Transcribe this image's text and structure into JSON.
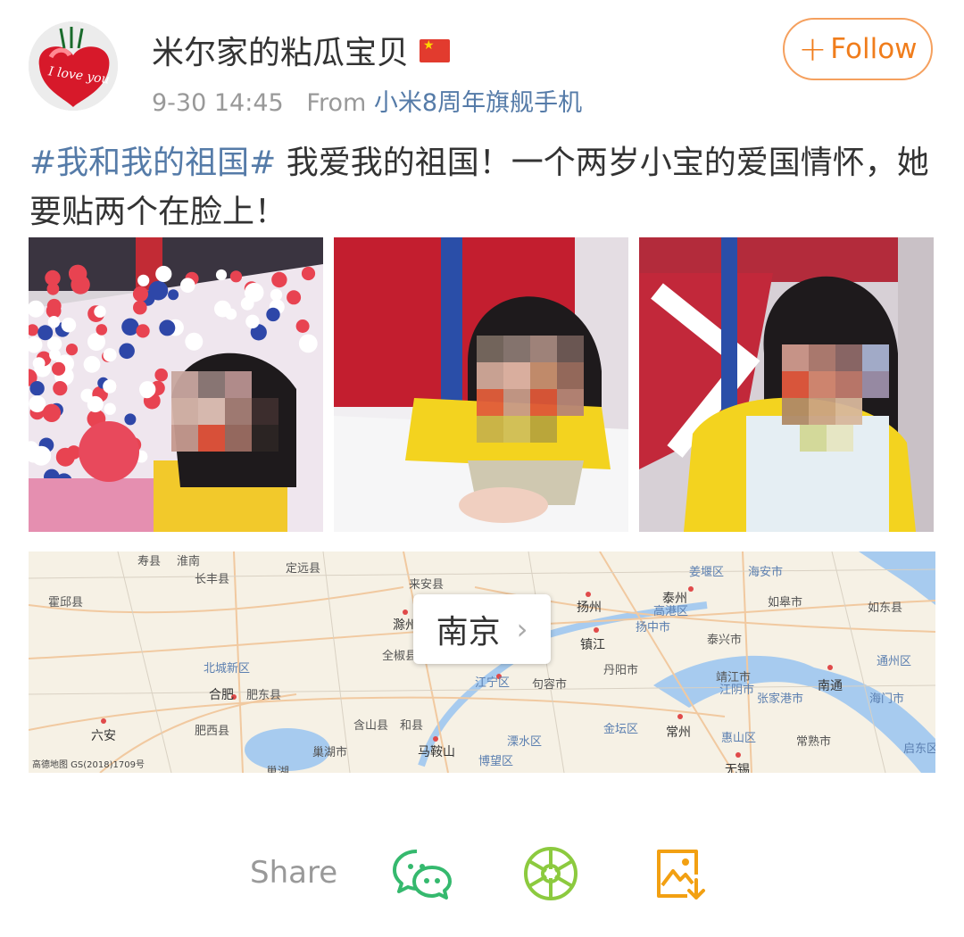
{
  "post": {
    "username": "米尔家的粘瓜宝贝",
    "time": "9-30 14:45",
    "from_prefix": "From",
    "source": "小米8周年旗舰手机",
    "follow_label": "Follow",
    "follow_plus": "+",
    "hashtag": "#我和我的祖国#",
    "body": " 我爱我的祖国！一个两岁小宝的爱国情怀，她要贴两个在脸上！",
    "avatar_text": "I love you"
  },
  "map": {
    "city": "南京",
    "credit": "高德地图 GS(2018)1709号",
    "labels": [
      "寿县",
      "淮南",
      "定远县",
      "来安县",
      "姜堰区",
      "海安市",
      "霍邱县",
      "长丰县",
      "泰州",
      "如皋市",
      "如东县",
      "扬州",
      "高港区",
      "滁州",
      "扬中市",
      "全椒县",
      "镇江",
      "泰兴市",
      "北城新区",
      "丹阳市",
      "靖江市",
      "通州区",
      "合肥",
      "肥东县",
      "江宁区",
      "句容市",
      "江阴市",
      "张家港市",
      "南通",
      "海门市",
      "六安",
      "含山县",
      "和县",
      "金坛区",
      "常州",
      "肥西县",
      "溧水区",
      "惠山区",
      "常熟市",
      "启东区",
      "巢湖市",
      "马鞍山",
      "博望区",
      "无锡",
      "巢湖"
    ]
  },
  "share": {
    "label": "Share",
    "icons": [
      "wechat-icon",
      "moments-icon",
      "save-image-icon"
    ]
  },
  "colors": {
    "accent": "#f07d1c",
    "link": "#557ba8"
  }
}
